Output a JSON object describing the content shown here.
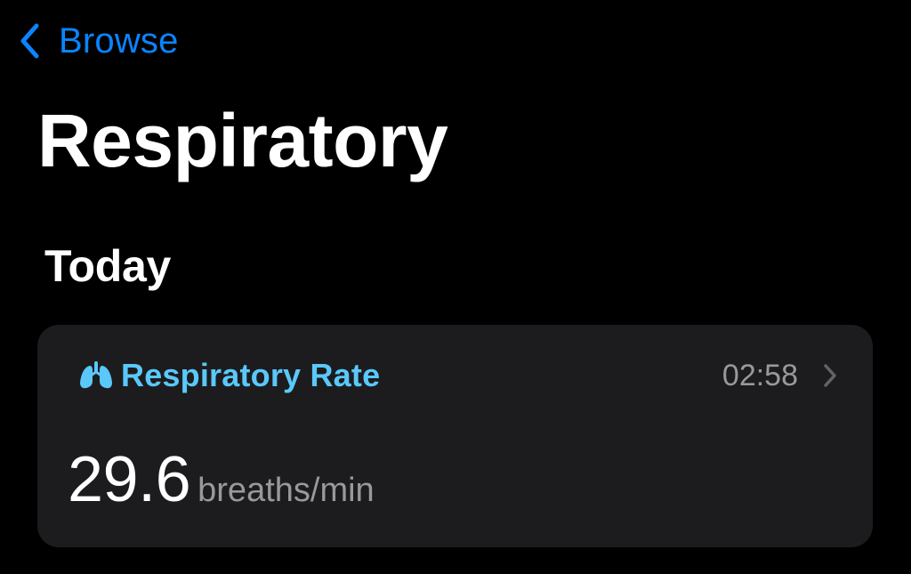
{
  "nav": {
    "back_label": "Browse",
    "back_icon": "chevron-left-icon"
  },
  "page": {
    "title": "Respiratory"
  },
  "section": {
    "heading": "Today"
  },
  "card": {
    "icon": "lungs-icon",
    "title": "Respiratory Rate",
    "time": "02:58",
    "value": "29.6",
    "unit": "breaths/min",
    "disclosure_icon": "chevron-right-icon"
  },
  "colors": {
    "background": "#000000",
    "card_background": "#1c1c1e",
    "accent_blue": "#0a84ff",
    "respiratory_accent": "#5ac8fa",
    "secondary_text": "#98989d",
    "primary_text": "#ffffff"
  }
}
